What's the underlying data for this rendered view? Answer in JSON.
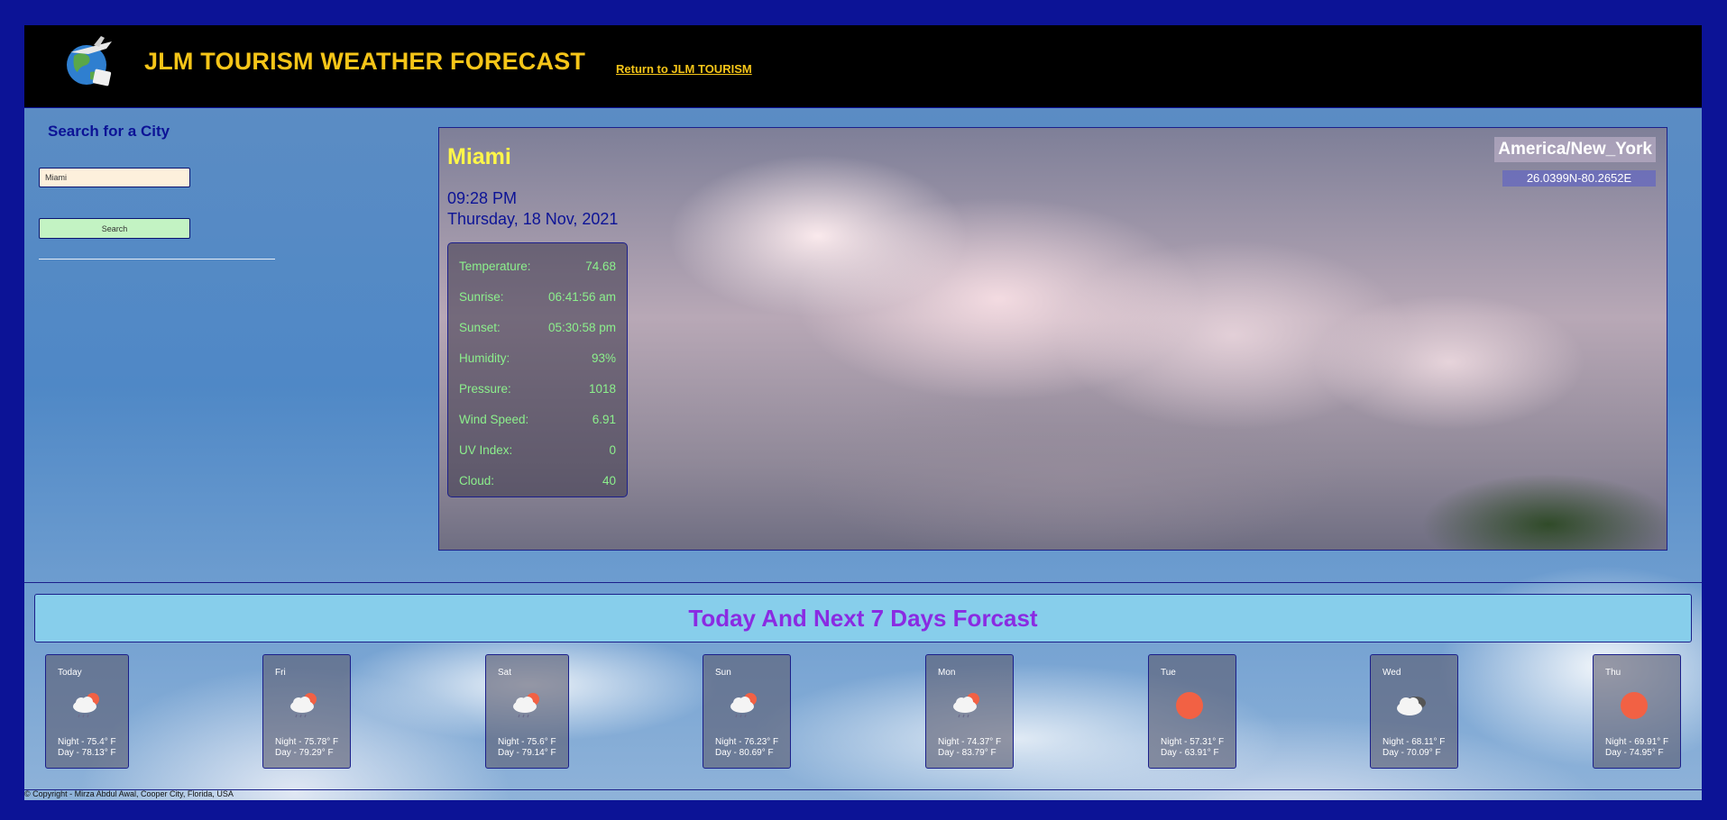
{
  "header": {
    "site_title": "JLM TOURISM WEATHER FORECAST",
    "return_link": "Return to JLM TOURISM"
  },
  "sidebar": {
    "heading": "Search for a City",
    "search_value": "Miami",
    "search_button": "Search"
  },
  "current": {
    "city": "Miami",
    "time": "09:28 PM",
    "date": "Thursday, 18 Nov, 2021",
    "timezone": "America/New_York",
    "coordinates": "26.0399N-80.2652E",
    "stats": [
      {
        "label": "Temperature:",
        "value": "74.68"
      },
      {
        "label": "Sunrise:",
        "value": "06:41:56 am"
      },
      {
        "label": "Sunset:",
        "value": "05:30:58 pm"
      },
      {
        "label": "Humidity:",
        "value": "93%"
      },
      {
        "label": "Pressure:",
        "value": "1018"
      },
      {
        "label": "Wind Speed:",
        "value": "6.91"
      },
      {
        "label": "UV Index:",
        "value": "0"
      },
      {
        "label": "Cloud:",
        "value": "40"
      }
    ]
  },
  "forecast": {
    "title": "Today And Next 7 Days Forcast",
    "days": [
      {
        "day": "Today",
        "icon": "cloud-sun-rain-icon",
        "night": "Night - 75.4° F",
        "daytime": "Day - 78.13° F"
      },
      {
        "day": "Fri",
        "icon": "cloud-sun-rain-icon",
        "night": "Night - 75.78° F",
        "daytime": "Day - 79.29° F"
      },
      {
        "day": "Sat",
        "icon": "cloud-sun-rain-icon",
        "night": "Night - 75.6° F",
        "daytime": "Day - 79.14° F"
      },
      {
        "day": "Sun",
        "icon": "cloud-sun-rain-icon",
        "night": "Night - 76.23° F",
        "daytime": "Day - 80.69° F"
      },
      {
        "day": "Mon",
        "icon": "cloud-sun-rain-icon",
        "night": "Night - 74.37° F",
        "daytime": "Day - 83.79° F"
      },
      {
        "day": "Tue",
        "icon": "sun-icon",
        "night": "Night - 57.31° F",
        "daytime": "Day - 63.91° F"
      },
      {
        "day": "Wed",
        "icon": "cloud-icon",
        "night": "Night - 68.11° F",
        "daytime": "Day - 70.09° F"
      },
      {
        "day": "Thu",
        "icon": "sun-icon",
        "night": "Night - 69.91° F",
        "daytime": "Day - 74.95° F"
      }
    ]
  },
  "footer": {
    "copyright": "© Copyright - Mirza Abdul Awal, Cooper City, Florida, USA"
  },
  "colors": {
    "frame": "#0c1396",
    "title": "#f5c518",
    "stats_text": "#8cf08c",
    "banner_bg": "#87ceeb",
    "banner_text": "#8a2be2",
    "sun": "#f26144"
  }
}
